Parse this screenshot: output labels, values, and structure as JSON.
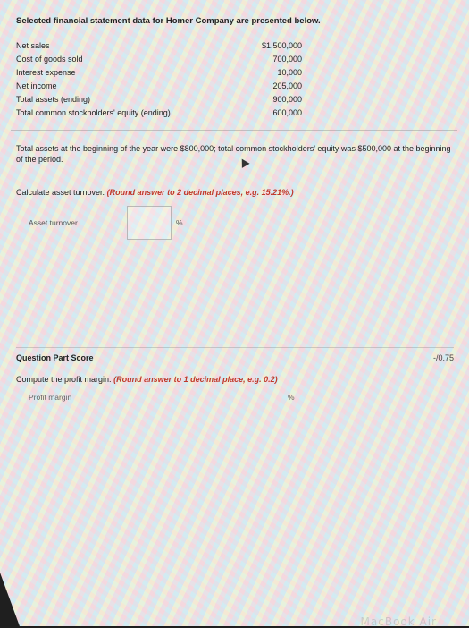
{
  "intro": "Selected financial statement data for Homer Company are presented below.",
  "financials": [
    {
      "label": "Net sales",
      "value": "$1,500,000"
    },
    {
      "label": "Cost of goods sold",
      "value": "700,000"
    },
    {
      "label": "Interest expense",
      "value": "10,000"
    },
    {
      "label": "Net income",
      "value": "205,000"
    },
    {
      "label": "Total assets (ending)",
      "value": "900,000"
    },
    {
      "label": "Total common stockholders' equity (ending)",
      "value": "600,000"
    }
  ],
  "assets_note": "Total assets at the beginning of the year were $800,000; total common stockholders' equity was $500,000 at the beginning of the period.",
  "q1": {
    "prompt": "Calculate asset turnover.",
    "instruction": "(Round answer to 2 decimal places, e.g. 15.21%.)",
    "field_label": "Asset turnover",
    "unit": "%",
    "value": ""
  },
  "score": {
    "label": "Question Part Score",
    "value": "-/0.75"
  },
  "q2": {
    "prompt": "Compute the profit margin.",
    "instruction": "(Round answer to 1 decimal place, e.g. 0.2)",
    "field_label": "Profit margin",
    "unit": "%"
  },
  "watermark": "MacBook Air"
}
